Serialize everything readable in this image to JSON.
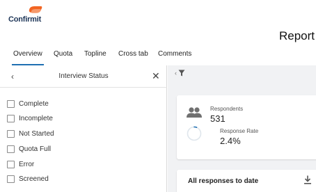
{
  "app": {
    "logo_text": "Confirmit",
    "page_title": "Report"
  },
  "tabs": [
    {
      "label": "Overview",
      "active": true
    },
    {
      "label": "Quota",
      "active": false
    },
    {
      "label": "Topline",
      "active": false
    },
    {
      "label": "Cross tab",
      "active": false
    },
    {
      "label": "Comments",
      "active": false
    }
  ],
  "filter_panel": {
    "back_glyph": "‹",
    "title": "Interview Status",
    "close_glyph": "✕",
    "statuses": [
      {
        "label": "Complete",
        "checked": false
      },
      {
        "label": "Incomplete",
        "checked": false
      },
      {
        "label": "Not Started",
        "checked": false
      },
      {
        "label": "Quota Full",
        "checked": false
      },
      {
        "label": "Error",
        "checked": false
      },
      {
        "label": "Screened",
        "checked": false
      }
    ]
  },
  "filter_bar": {
    "chevron_glyph": "‹",
    "icon": "filter-icon"
  },
  "stats": {
    "respondents_label": "Respondents",
    "respondents_value": "531",
    "response_rate_label": "Response Rate",
    "response_rate_value": "2.4%",
    "response_rate_fraction": 0.024,
    "icons": [
      "people-icon",
      "progress-ring-icon"
    ]
  },
  "responses_card": {
    "title": "All responses to date",
    "icon": "download-icon"
  },
  "colors": {
    "accent": "#1f6fb2",
    "logo_orange": "#f26522",
    "logo_navy": "#1d3557",
    "background_gray": "#f1f2f4"
  }
}
